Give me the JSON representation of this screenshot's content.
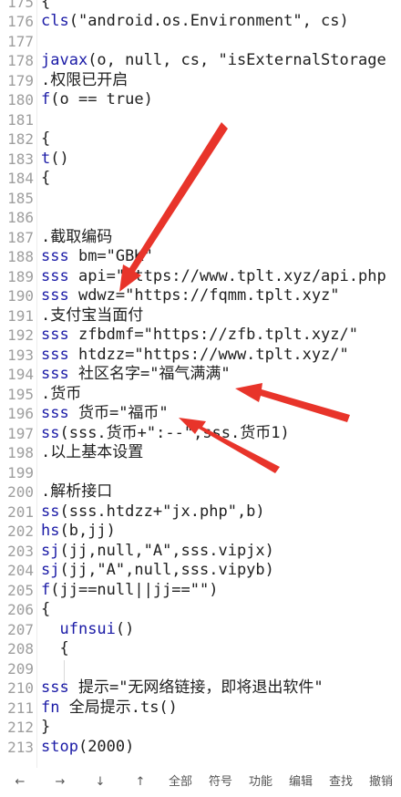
{
  "editor": {
    "lines": [
      {
        "n": "175",
        "text": "{"
      },
      {
        "n": "176",
        "kw": "cls",
        "text": "(\"android.os.Environment\", cs)"
      },
      {
        "n": "177",
        "text": ""
      },
      {
        "n": "178",
        "kw": "javax",
        "text": "(o, null, cs, \"isExternalStorage"
      },
      {
        "n": "179",
        "text": ".权限已开启"
      },
      {
        "n": "180",
        "kw": "f",
        "text": "(o == true)"
      },
      {
        "n": "181",
        "text": ""
      },
      {
        "n": "182",
        "text": "{"
      },
      {
        "n": "183",
        "kw": "t",
        "text": "()"
      },
      {
        "n": "184",
        "text": "{"
      },
      {
        "n": "185",
        "text": ""
      },
      {
        "n": "186",
        "text": ""
      },
      {
        "n": "187",
        "text": ".截取编码"
      },
      {
        "n": "188",
        "kw": "sss",
        "text": " bm=\"GBK\""
      },
      {
        "n": "189",
        "kw": "sss",
        "text": " api=\"https://www.tplt.xyz/api.php"
      },
      {
        "n": "190",
        "kw": "sss",
        "text": " wdwz=\"https://fqmm.tplt.xyz\""
      },
      {
        "n": "191",
        "text": ".支付宝当面付"
      },
      {
        "n": "192",
        "kw": "sss",
        "text": " zfbdmf=\"https://zfb.tplt.xyz/\""
      },
      {
        "n": "193",
        "kw": "sss",
        "text": " htdzz=\"https://www.tplt.xyz/\""
      },
      {
        "n": "194",
        "kw": "sss",
        "text": " 社区名字=\"福气满满\""
      },
      {
        "n": "195",
        "text": ".货币"
      },
      {
        "n": "196",
        "kw": "sss",
        "text": " 货币=\"福币\""
      },
      {
        "n": "197",
        "kw": "ss",
        "text": "(sss.货币+\":--\",sss.货币1)"
      },
      {
        "n": "198",
        "text": ".以上基本设置"
      },
      {
        "n": "199",
        "text": ""
      },
      {
        "n": "200",
        "text": ".解析接口"
      },
      {
        "n": "201",
        "kw": "ss",
        "text": "(sss.htdzz+\"jx.php\",b)"
      },
      {
        "n": "202",
        "kw": "hs",
        "text": "(b,jj)"
      },
      {
        "n": "203",
        "kw": "sj",
        "text": "(jj,null,\"A\",sss.vipjx)"
      },
      {
        "n": "204",
        "kw": "sj",
        "text": "(jj,\"A\",null,sss.vipyb)"
      },
      {
        "n": "205",
        "kw": "f",
        "text": "(jj==null||jj==\"\")"
      },
      {
        "n": "206",
        "text": "{"
      },
      {
        "n": "207",
        "pre": "  ",
        "kw": "ufnsui",
        "text": "()"
      },
      {
        "n": "208",
        "text": "  {"
      },
      {
        "n": "209",
        "text": ""
      },
      {
        "n": "210",
        "kw": "sss",
        "text": " 提示=\"无网络链接，即将退出软件\""
      },
      {
        "n": "211",
        "kw": "fn",
        "text": " 全局提示.ts()"
      },
      {
        "n": "212",
        "text": "}"
      },
      {
        "n": "213",
        "kw": "stop",
        "text": "(2000)"
      }
    ]
  },
  "toolbar": {
    "left_arrow": "←",
    "right_arrow": "→",
    "down_arrow": "↓",
    "up_arrow": "↑",
    "select_all": "全部",
    "symbols": "符号",
    "functions": "功能",
    "edit": "编辑",
    "search": "查找",
    "undo": "撤销"
  },
  "colors": {
    "keyword": "#1a1aa6",
    "line_number": "#9e9e9e",
    "annotation_arrow": "#e8342a"
  }
}
